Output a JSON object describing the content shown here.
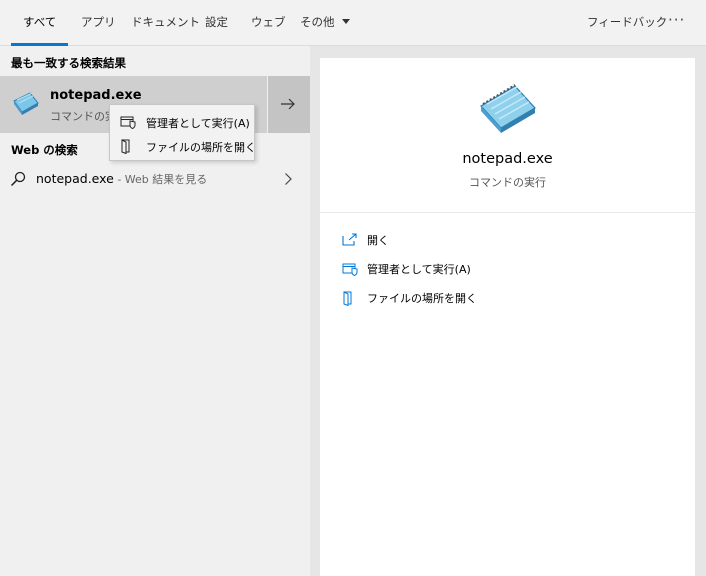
{
  "tabs": [
    {
      "label": "すべて",
      "active": true
    },
    {
      "label": "アプリ"
    },
    {
      "label": "ドキュメント"
    },
    {
      "label": "設定"
    },
    {
      "label": "ウェブ"
    },
    {
      "label": "その他"
    }
  ],
  "feedback_label": "フィードバック",
  "more_label": "···",
  "best_match": {
    "section_title": "最も一致する検索結果",
    "title": "notepad.exe",
    "subtitle": "コマンドの実行"
  },
  "context_menu": [
    {
      "label": "管理者として実行(A)",
      "icon": "shield-icon"
    },
    {
      "label": "ファイルの場所を開く",
      "icon": "file-location-icon"
    }
  ],
  "web_search": {
    "section_title": "Web の検索",
    "query": "notepad.exe",
    "hint": " - Web 結果を見る"
  },
  "preview": {
    "title": "notepad.exe",
    "subtitle": "コマンドの実行",
    "actions": [
      {
        "label": "開く",
        "icon": "open-icon"
      },
      {
        "label": "管理者として実行(A)",
        "icon": "shield-icon"
      },
      {
        "label": "ファイルの場所を開く",
        "icon": "file-location-icon"
      }
    ]
  },
  "colors": {
    "accent": "#0078d7",
    "selected_bg": "#cfcfcf"
  }
}
